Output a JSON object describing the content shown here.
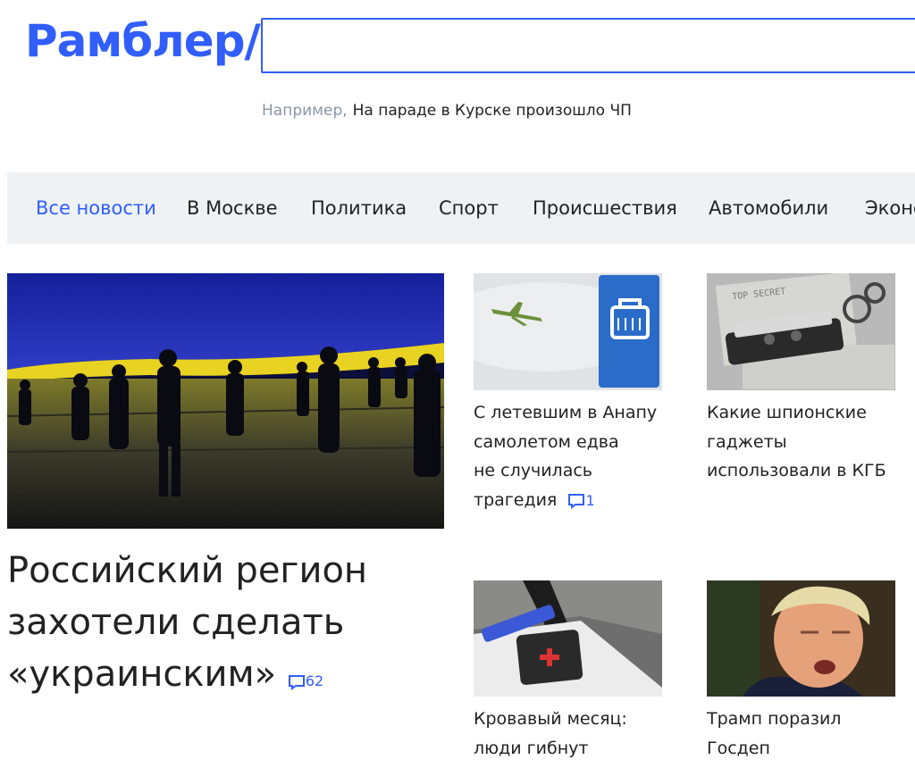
{
  "header": {
    "logo": "Рамблер/",
    "search": {
      "value": "",
      "placeholder": ""
    },
    "hint_prefix": "Например,",
    "hint_suggestion": "На параде в Курске произошло ЧП"
  },
  "nav": {
    "items": [
      {
        "label": "Все новости",
        "active": true
      },
      {
        "label": "В Москве"
      },
      {
        "label": "Политика"
      },
      {
        "label": "Спорт"
      },
      {
        "label": "Происшествия"
      },
      {
        "label": "Автомобили"
      },
      {
        "label": "Эконо"
      }
    ]
  },
  "main_story": {
    "title_line1": "Российский регион",
    "title_line2": "захотели сделать",
    "title_line3": "«украинским»",
    "comments": "62"
  },
  "cards": [
    {
      "line1": "С летевшим в Анапу",
      "line2": "самолетом едва",
      "line3": "не случилась",
      "line4": "трагедия",
      "comments": "1"
    },
    {
      "line1": "Какие шпионские",
      "line2": "гаджеты",
      "line3": "использовали в КГБ"
    },
    {
      "line1": "Кровавый месяц:",
      "line2": "люди гибнут"
    },
    {
      "line1": "Трамп поразил",
      "line2": "Госдеп"
    }
  ],
  "image_text": {
    "top_secret": "TOP SECRET"
  },
  "colors": {
    "brand": "#315efb",
    "nav_bg": "#eef2f5"
  },
  "icons": {
    "comment": "comment-bubble-icon"
  }
}
